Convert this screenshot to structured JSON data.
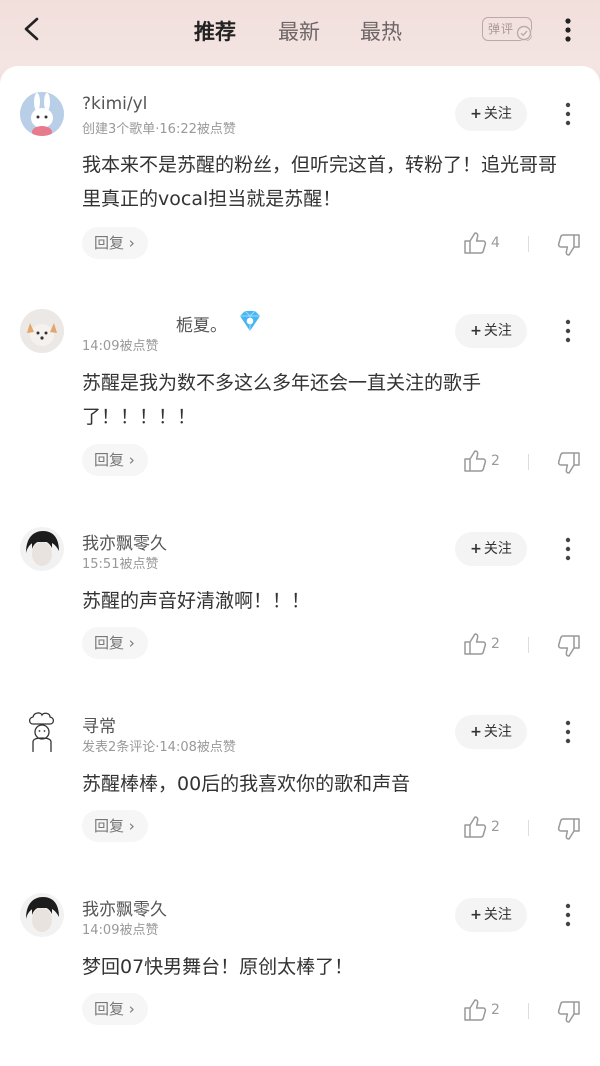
{
  "header": {
    "tabs": [
      {
        "label": "推荐",
        "active": true
      },
      {
        "label": "最新",
        "active": false
      },
      {
        "label": "最热",
        "active": false
      }
    ],
    "danmu_label": "弹评"
  },
  "comments": [
    {
      "username": "?kimi/yl",
      "meta": "创建3个歌单·16:22被点赞",
      "follow_label": "关注",
      "content": "我本来不是苏醒的粉丝，但听完这首，转粉了！追光哥哥里真正的vocal担当就是苏醒！",
      "reply_label": "回复 ›",
      "likes": "4"
    },
    {
      "username": "栀夏。",
      "meta": "14:09被点赞",
      "follow_label": "关注",
      "content": "苏醒是我为数不多这么多年还会一直关注的歌手了！！！！！",
      "reply_label": "回复 ›",
      "likes": "2"
    },
    {
      "username": "我亦飘零久",
      "meta": "15:51被点赞",
      "follow_label": "关注",
      "content": "苏醒的声音好清澈啊！！！",
      "reply_label": "回复 ›",
      "likes": "2"
    },
    {
      "username": "寻常",
      "meta": "发表2条评论·14:08被点赞",
      "follow_label": "关注",
      "content": "苏醒棒棒，00后的我喜欢你的歌和声音",
      "reply_label": "回复 ›",
      "likes": "2"
    },
    {
      "username": "我亦飘零久",
      "meta": "14:09被点赞",
      "follow_label": "关注",
      "content": "梦回07快男舞台！原创太棒了！",
      "reply_label": "回复 ›",
      "likes": "2"
    }
  ]
}
